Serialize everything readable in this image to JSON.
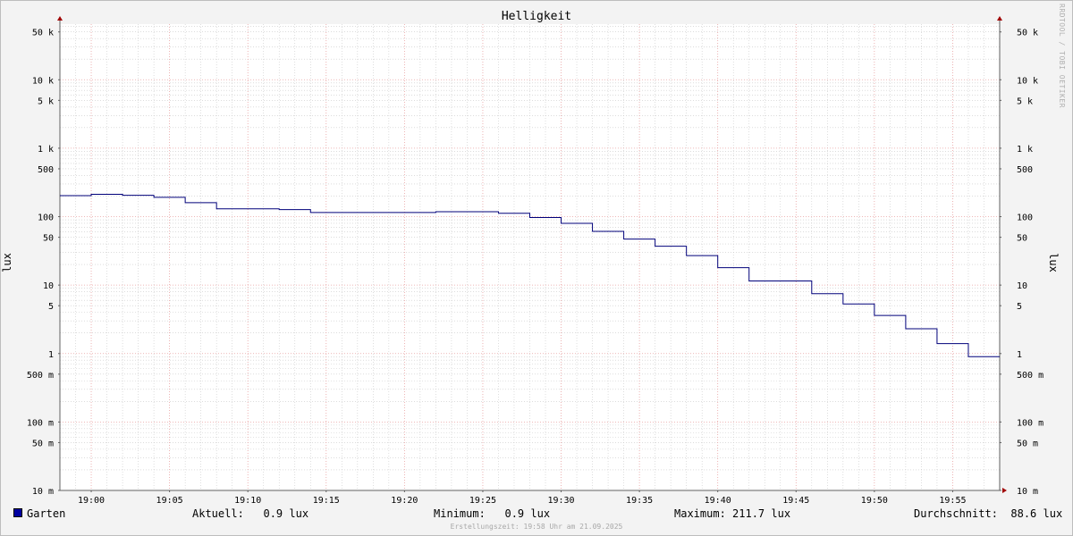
{
  "title": "Helligkeit",
  "ylabel": "lux",
  "watermark": "RRDTOOL / TOBI OETIKER",
  "footer": "Erstellungszeit: 19:58 Uhr am 21.09.2025",
  "legend": {
    "name": "Garten",
    "color": "#0000a0",
    "current": "Aktuell:   0.9 lux",
    "minimum": "Minimum:   0.9 lux",
    "maximum": "Maximum: 211.7 lux",
    "average": "Durchschnitt:  88.6 lux"
  },
  "colors": {
    "line": "#00007a",
    "major_grid": "#e8a0a0",
    "minor_grid": "#c8c8c8",
    "axis": "#606060",
    "arrow": "#a00000",
    "canvas": "#ffffff",
    "background": "#f3f3f3"
  },
  "chart_data": {
    "type": "line",
    "step": true,
    "scale": "log",
    "ylim": [
      0.01,
      65000
    ],
    "xlim": [
      "18:58",
      "19:58"
    ],
    "x_tick_labels": [
      "19:00",
      "19:05",
      "19:10",
      "19:15",
      "19:20",
      "19:25",
      "19:30",
      "19:35",
      "19:40",
      "19:45",
      "19:50",
      "19:55"
    ],
    "y_tick_labels": [
      {
        "value": 50000,
        "label": "50 k"
      },
      {
        "value": 10000,
        "label": "10 k"
      },
      {
        "value": 5000,
        "label": "5 k"
      },
      {
        "value": 1000,
        "label": "1 k"
      },
      {
        "value": 500,
        "label": "500"
      },
      {
        "value": 100,
        "label": "100"
      },
      {
        "value": 50,
        "label": "50"
      },
      {
        "value": 10,
        "label": "10"
      },
      {
        "value": 5,
        "label": "5"
      },
      {
        "value": 1,
        "label": "1"
      },
      {
        "value": 0.5,
        "label": "500 m"
      },
      {
        "value": 0.1,
        "label": "100 m"
      },
      {
        "value": 0.05,
        "label": "50 m"
      },
      {
        "value": 0.01,
        "label": "10 m"
      }
    ],
    "series": [
      {
        "name": "Garten",
        "points": [
          {
            "x": "18:58",
            "y": 203
          },
          {
            "x": "19:00",
            "y": 212
          },
          {
            "x": "19:02",
            "y": 205
          },
          {
            "x": "19:04",
            "y": 192
          },
          {
            "x": "19:06",
            "y": 160
          },
          {
            "x": "19:08",
            "y": 130
          },
          {
            "x": "19:12",
            "y": 127
          },
          {
            "x": "19:14",
            "y": 115
          },
          {
            "x": "19:22",
            "y": 118
          },
          {
            "x": "19:26",
            "y": 112
          },
          {
            "x": "19:28",
            "y": 97
          },
          {
            "x": "19:30",
            "y": 80
          },
          {
            "x": "19:32",
            "y": 61
          },
          {
            "x": "19:34",
            "y": 47
          },
          {
            "x": "19:36",
            "y": 37
          },
          {
            "x": "19:38",
            "y": 27
          },
          {
            "x": "19:40",
            "y": 18
          },
          {
            "x": "19:42",
            "y": 11.5
          },
          {
            "x": "19:46",
            "y": 7.5
          },
          {
            "x": "19:48",
            "y": 5.3
          },
          {
            "x": "19:50",
            "y": 3.6
          },
          {
            "x": "19:52",
            "y": 2.3
          },
          {
            "x": "19:54",
            "y": 1.4
          },
          {
            "x": "19:56",
            "y": 0.9
          },
          {
            "x": "19:58",
            "y": 0.9
          }
        ]
      }
    ]
  }
}
